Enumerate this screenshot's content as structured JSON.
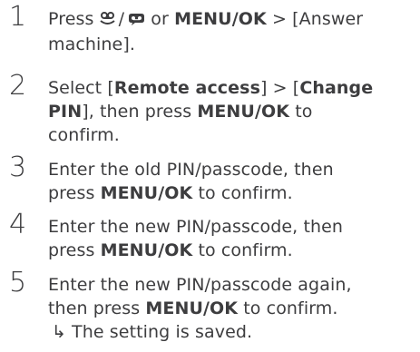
{
  "steps": [
    {
      "number": "1",
      "lines": [
        [
          "Press ",
          "/",
          " or ",
          "MENU/OK",
          " > [Answer"
        ],
        [
          "machine]."
        ]
      ]
    },
    {
      "number": "2",
      "lines": [
        [
          "Select [",
          "Remote access",
          "] > [",
          "Change"
        ],
        [
          "PIN",
          "], then press ",
          "MENU/OK",
          " to"
        ],
        [
          "confirm."
        ]
      ]
    },
    {
      "number": "3",
      "lines": [
        [
          "Enter the old PIN/passcode, then"
        ],
        [
          "press ",
          "MENU/OK",
          " to confirm."
        ]
      ]
    },
    {
      "number": "4",
      "lines": [
        [
          "Enter the new PIN/passcode, then"
        ],
        [
          "press ",
          "MENU/OK",
          " to confirm."
        ]
      ]
    },
    {
      "number": "5",
      "lines": [
        [
          "Enter the new PIN/passcode again,"
        ],
        [
          "then press ",
          "MENU/OK",
          " to confirm."
        ]
      ],
      "result_arrow": "↳",
      "result": "The setting is saved."
    }
  ],
  "icons": [
    "answering-machine-icon",
    "voicemail-icon"
  ],
  "text_color": "#3d3d3f"
}
